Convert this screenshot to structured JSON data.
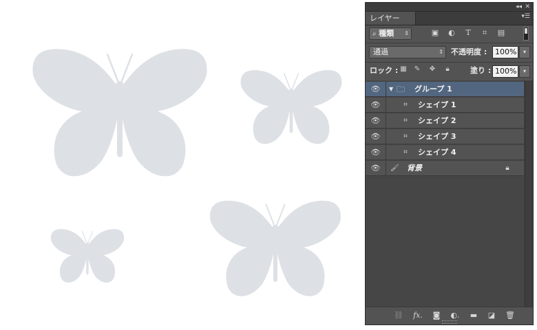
{
  "panel": {
    "tab_label": "レイヤー",
    "collapse_icon": "double-chevron-left-icon",
    "close_icon": "close-icon",
    "menu_icon": "panel-menu-icon"
  },
  "filter": {
    "kind_label": "種類",
    "icons": [
      "search-icon",
      "image-filter-icon",
      "adjustment-filter-icon",
      "type-filter-icon",
      "shape-filter-icon",
      "smart-object-filter-icon"
    ]
  },
  "blend": {
    "mode": "通過",
    "opacity_label": "不透明度 :",
    "opacity_value": "100%",
    "lock_label": "ロック :",
    "fill_label": "塗り :",
    "fill_value": "100%"
  },
  "layers": [
    {
      "name": "グループ 1",
      "type": "group",
      "selected": true
    },
    {
      "name": "シェイプ 1",
      "type": "shape",
      "selected": false
    },
    {
      "name": "シェイプ 2",
      "type": "shape",
      "selected": false
    },
    {
      "name": "シェイプ 3",
      "type": "shape",
      "selected": false
    },
    {
      "name": "シェイプ 4",
      "type": "shape",
      "selected": false
    },
    {
      "name": "背景",
      "type": "background",
      "selected": false,
      "locked": true
    }
  ],
  "footer_icons": [
    "link-icon",
    "fx-icon",
    "mask-icon",
    "adjustment-layer-icon",
    "new-group-icon",
    "new-layer-icon",
    "trash-icon"
  ],
  "colors": {
    "butterfly": "#dde1e5",
    "panel_bg": "#535353",
    "selected_layer": "#52667f"
  }
}
